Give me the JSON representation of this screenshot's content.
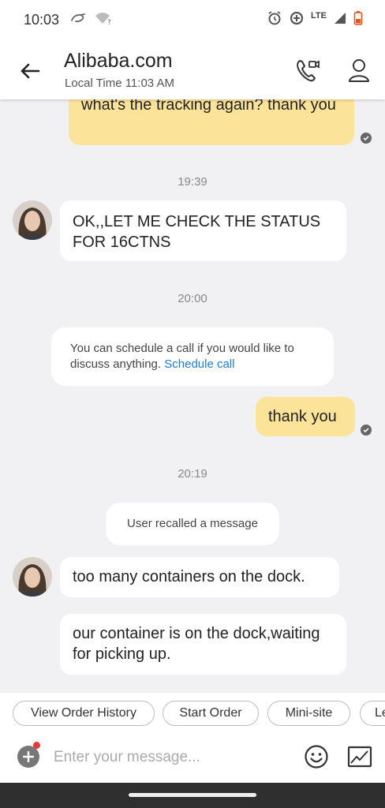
{
  "status_bar": {
    "time": "10:03",
    "network_label": "LTE",
    "icons": [
      "alibaba-logo-icon",
      "wifi-unknown-icon",
      "alarm-icon",
      "data-saver-icon",
      "signal-icon",
      "battery-low-icon"
    ]
  },
  "header": {
    "title": "Alibaba.com",
    "subtitle": "Local Time 11:03 AM",
    "icons": [
      "back-arrow-icon",
      "video-call-icon",
      "profile-icon"
    ]
  },
  "messages": {
    "out_1": "what's the tracking again? thank you",
    "time_1": "19:39",
    "in_1": "OK,,LET ME CHECK THE STATUS FOR 16CTNS",
    "time_2": "20:00",
    "system_text": "You can schedule a call if you would like to discuss anything.",
    "system_link": "Schedule call",
    "out_2": "thank you",
    "time_3": "20:19",
    "recalled": "User recalled a message",
    "in_2": "too many containers on the dock.",
    "in_3": "our container is on the dock,waiting for picking up."
  },
  "quick_actions": [
    "View Order History",
    "Start Order",
    "Mini-site",
    "Le"
  ],
  "input": {
    "placeholder": "Enter your message...",
    "icons": [
      "plus-icon",
      "emoji-icon",
      "image-icon"
    ]
  },
  "colors": {
    "outgoing_bubble": "#fbe49a",
    "incoming_bubble": "#ffffff",
    "chat_background": "#f1f1f4",
    "link": "#1e7bd6",
    "notification_dot": "#e53935"
  }
}
